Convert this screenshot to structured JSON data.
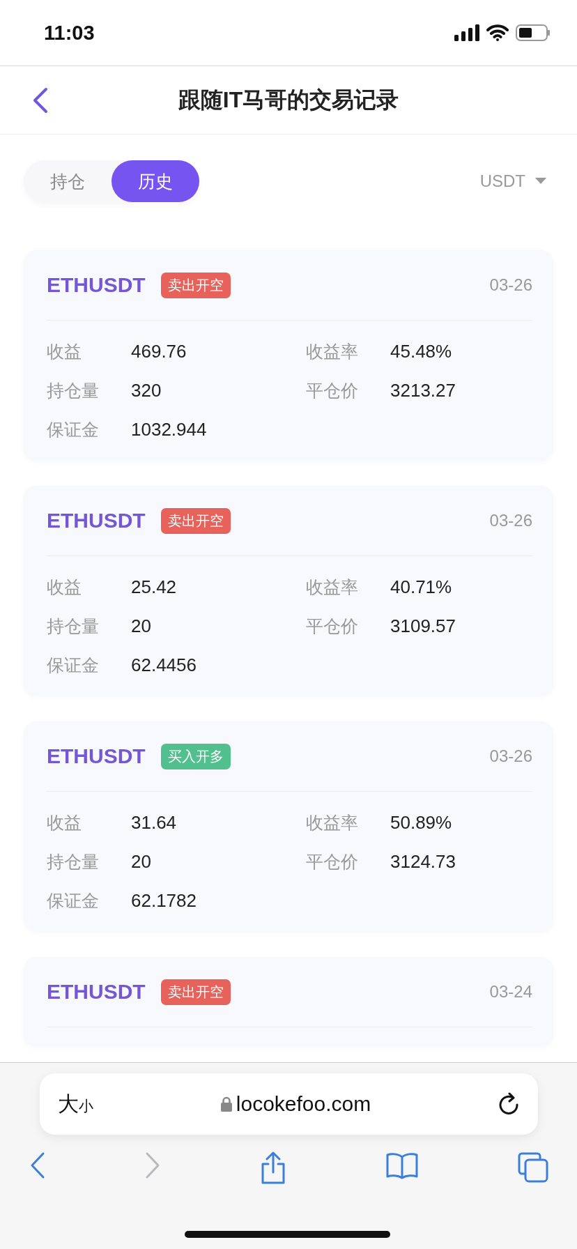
{
  "status_bar": {
    "time": "11:03"
  },
  "nav": {
    "title": "跟随IT马哥的交易记录"
  },
  "tabs": [
    {
      "label": "持仓",
      "selected": false
    },
    {
      "label": "历史",
      "selected": true
    }
  ],
  "currency": {
    "label": "USDT"
  },
  "cards": [
    {
      "symbol": "ETHUSDT",
      "badge": {
        "label": "卖出开空",
        "color": "#e8625c"
      },
      "date": "03-26",
      "fields": [
        {
          "label": "收益",
          "value": "469.76"
        },
        {
          "label": "收益率",
          "value": "45.48%"
        },
        {
          "label": "持仓量",
          "value": "320"
        },
        {
          "label": "平仓价",
          "value": "3213.27"
        },
        {
          "label": "保证金",
          "value": "1032.944"
        }
      ]
    },
    {
      "symbol": "ETHUSDT",
      "badge": {
        "label": "卖出开空",
        "color": "#e8625c"
      },
      "date": "03-26",
      "fields": [
        {
          "label": "收益",
          "value": "25.42"
        },
        {
          "label": "收益率",
          "value": "40.71%"
        },
        {
          "label": "持仓量",
          "value": "20"
        },
        {
          "label": "平仓价",
          "value": "3109.57"
        },
        {
          "label": "保证金",
          "value": "62.4456"
        }
      ]
    },
    {
      "symbol": "ETHUSDT",
      "badge": {
        "label": "买入开多",
        "color": "#52c08e"
      },
      "date": "03-26",
      "fields": [
        {
          "label": "收益",
          "value": "31.64"
        },
        {
          "label": "收益率",
          "value": "50.89%"
        },
        {
          "label": "持仓量",
          "value": "20"
        },
        {
          "label": "平仓价",
          "value": "3124.73"
        },
        {
          "label": "保证金",
          "value": "62.1782"
        }
      ]
    },
    {
      "symbol": "ETHUSDT",
      "badge": {
        "label": "卖出开空",
        "color": "#e8625c"
      },
      "date": "03-24"
    }
  ],
  "browser": {
    "text_size": [
      "大",
      "小"
    ],
    "url": "locokefoo.com",
    "toolbar": [
      {
        "kind": "back",
        "disabled": false
      },
      {
        "kind": "forward",
        "disabled": true
      },
      {
        "kind": "share",
        "disabled": false
      },
      {
        "kind": "bookmarks",
        "disabled": false
      },
      {
        "kind": "tabs",
        "disabled": false
      }
    ]
  }
}
